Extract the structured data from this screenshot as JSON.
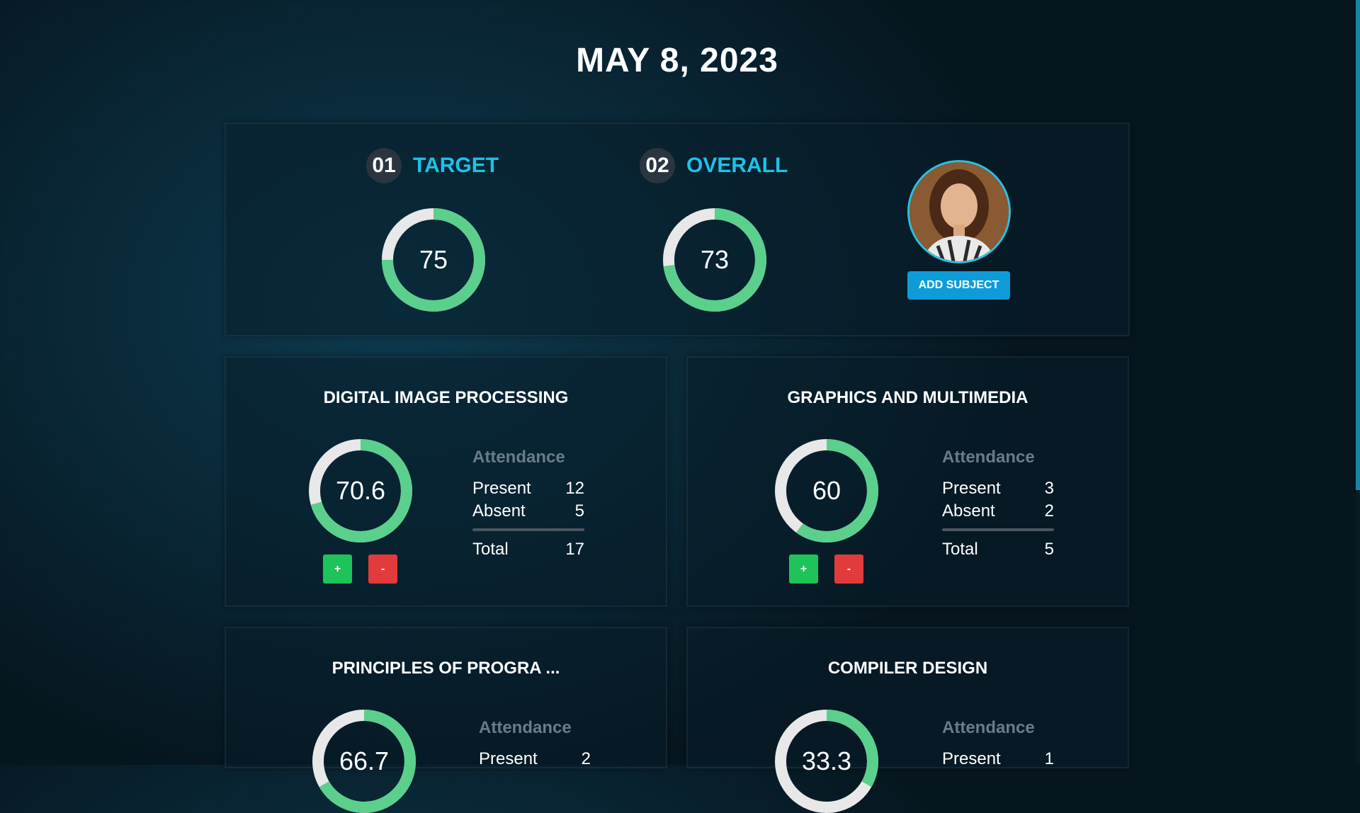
{
  "date": "MAY 8, 2023",
  "colors": {
    "ring_fill": "#5bcf8c",
    "ring_track": "#e8e8e8",
    "accent": "#1cc3e6",
    "plus": "#1ec35a",
    "minus": "#e23b3b"
  },
  "stats": {
    "target": {
      "num": "01",
      "label": "TARGET",
      "value": "75",
      "progress": 75
    },
    "overall": {
      "num": "02",
      "label": "OVERALL",
      "value": "73",
      "progress": 73
    }
  },
  "avatar": {
    "icon": "user-avatar-photo"
  },
  "add_subject_label": "ADD SUBJECT",
  "subjects": [
    {
      "title": "DIGITAL IMAGE PROCESSING",
      "value": "70.6",
      "progress": 70.6,
      "attendance_label": "Attendance",
      "present_label": "Present",
      "present": "12",
      "absent_label": "Absent",
      "absent": "5",
      "total_label": "Total",
      "total": "17",
      "plus_label": "+",
      "minus_label": "-"
    },
    {
      "title": "GRAPHICS AND MULTIMEDIA",
      "value": "60",
      "progress": 60,
      "attendance_label": "Attendance",
      "present_label": "Present",
      "present": "3",
      "absent_label": "Absent",
      "absent": "2",
      "total_label": "Total",
      "total": "5",
      "plus_label": "+",
      "minus_label": "-"
    },
    {
      "title": "PRINCIPLES OF PROGRA ...",
      "value": "66.7",
      "progress": 66.7,
      "attendance_label": "Attendance",
      "present_label": "Present",
      "present": "2"
    },
    {
      "title": "COMPILER DESIGN",
      "value": "33.3",
      "progress": 33.3,
      "attendance_label": "Attendance",
      "present_label": "Present",
      "present": "1"
    }
  ]
}
